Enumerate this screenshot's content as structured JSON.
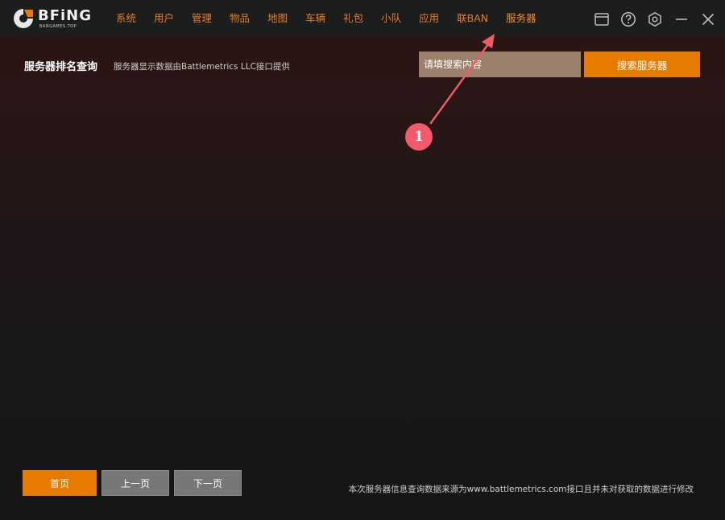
{
  "app": {
    "logo_text": "BFiNG",
    "logo_subtext": "BANGAMES.TOP"
  },
  "nav": {
    "items": [
      {
        "label": "系统"
      },
      {
        "label": "用户"
      },
      {
        "label": "管理"
      },
      {
        "label": "物品"
      },
      {
        "label": "地图"
      },
      {
        "label": "车辆"
      },
      {
        "label": "礼包"
      },
      {
        "label": "小队"
      },
      {
        "label": "应用"
      },
      {
        "label": "联BAN"
      },
      {
        "label": "服务器"
      }
    ],
    "active": "服务器"
  },
  "window_controls": {
    "icons": [
      "window-icon",
      "help-icon",
      "settings-icon",
      "minimize-icon",
      "close-icon"
    ]
  },
  "page": {
    "title": "服务器排名查询",
    "subtitle": "服务器显示数据由Battlemetrics  LLC接口提供"
  },
  "search": {
    "placeholder": "请填搜索内容",
    "value": "",
    "button_label": "搜索服务器"
  },
  "annotation": {
    "badge_label": "1"
  },
  "pager": {
    "first_label": "首页",
    "prev_label": "上一页",
    "next_label": "下一页"
  },
  "footer": {
    "note": "本次服务器信息查询数据来源为www.battlemetrics.com接口且并未对获取的数据进行修改"
  },
  "colors": {
    "accent": "#e77a00",
    "nav_text": "#e47e1c",
    "search_bg": "#9b806b",
    "annotation": "#f25a6c",
    "topbar": "#1d1d1d"
  }
}
